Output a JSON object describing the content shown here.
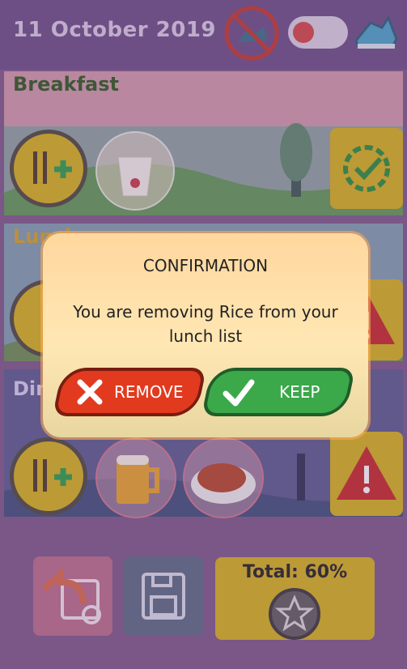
{
  "header": {
    "date": "11 October 2019",
    "toggle_state": "off"
  },
  "meals": [
    {
      "title": "Breakfast",
      "status_icon": "clock-check-icon",
      "items": [
        "yogurt"
      ]
    },
    {
      "title": "Lunch",
      "status_icon": "warning-icon",
      "items": []
    },
    {
      "title": "Dinner",
      "status_icon": "warning-icon",
      "items": [
        "beer",
        "chicken-wings"
      ]
    }
  ],
  "footer": {
    "total_label": "Total: 60%"
  },
  "dialog": {
    "title": "CONFIRMATION",
    "message": "You are removing Rice from your lunch list",
    "remove_label": "REMOVE",
    "keep_label": "KEEP"
  },
  "colors": {
    "accent_yellow": "#e9c418",
    "remove_red": "#e23a1e",
    "keep_green": "#3ba84a",
    "header_purple": "#6b4f86"
  }
}
